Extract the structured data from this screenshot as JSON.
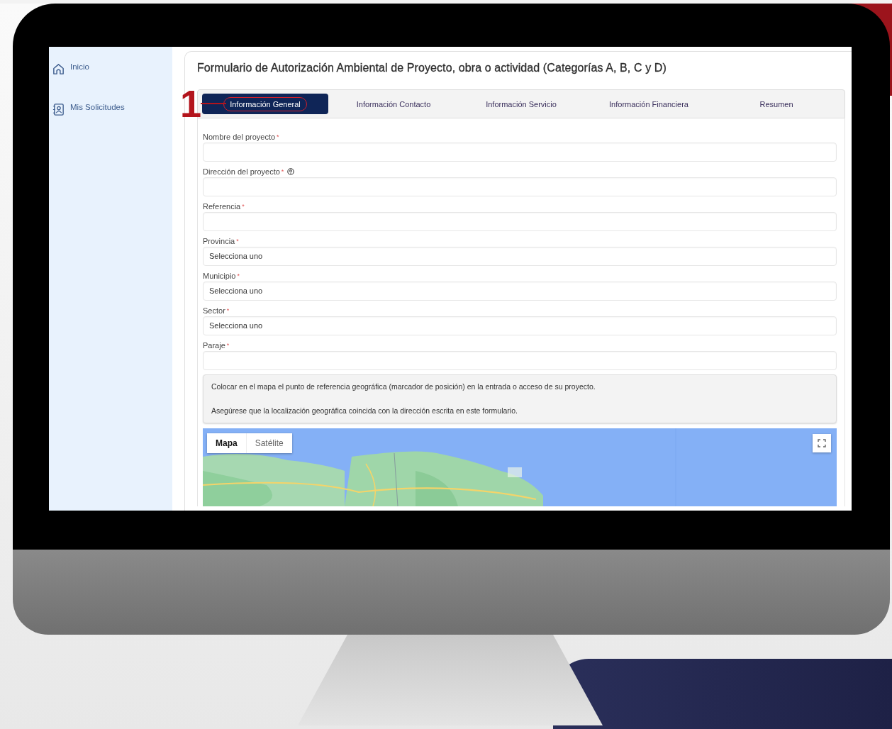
{
  "sidebar": {
    "items": [
      {
        "label": "Inicio"
      },
      {
        "label": "Mis Solicitudes"
      }
    ]
  },
  "form": {
    "title": "Formulario de Autorización Ambiental de Proyecto, obra o actividad (Categorías A, B, C y D)",
    "annotation": {
      "label": "1"
    },
    "tabs": [
      {
        "label": "Información General",
        "selected": true,
        "highlighted": true
      },
      {
        "label": "Información Contacto",
        "selected": false,
        "highlighted": false
      },
      {
        "label": "Información Servicio",
        "selected": false,
        "highlighted": false
      },
      {
        "label": "Información Financiera",
        "selected": false,
        "highlighted": false
      },
      {
        "label": "Resumen",
        "selected": false,
        "highlighted": false
      }
    ],
    "fields": [
      {
        "label": "Nombre del proyecto",
        "kind": "text",
        "required_mark": "*",
        "help": false
      },
      {
        "label": "Dirección del proyecto",
        "kind": "text",
        "required_mark": "*",
        "help": true
      },
      {
        "label": "Referencia",
        "kind": "text",
        "required_mark": "*",
        "help": false
      },
      {
        "label": "Provincia",
        "kind": "select",
        "required_mark": "*",
        "help": false,
        "value": "Selecciona uno"
      },
      {
        "label": "Municipio",
        "kind": "select",
        "required_mark": "*",
        "help": false,
        "value": "Selecciona uno"
      },
      {
        "label": "Sector",
        "kind": "select",
        "required_mark": "*",
        "help": false,
        "value": "Selecciona uno"
      },
      {
        "label": "Paraje",
        "kind": "text",
        "required_mark": "*",
        "help": false
      }
    ],
    "notice": [
      "Colocar en el mapa el punto de referencia geográfica (marcador de posición) en la entrada o acceso de su proyecto.",
      "Asegúrese que la localización geográfica coincida con la dirección escrita en este formulario."
    ],
    "map": {
      "kind": "picture",
      "view_buttons": [
        {
          "label": "Mapa",
          "selected": true
        },
        {
          "label": "Satélite",
          "selected": false
        }
      ]
    }
  }
}
